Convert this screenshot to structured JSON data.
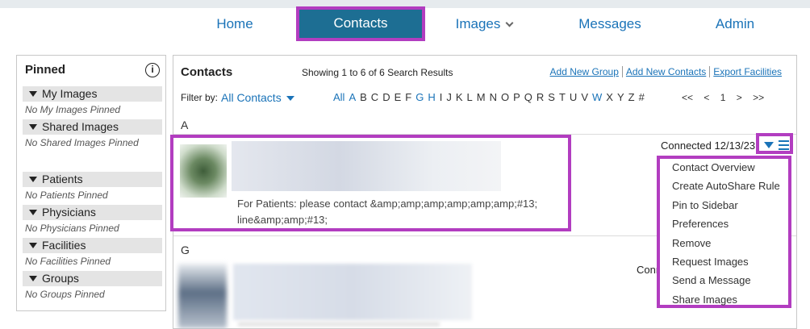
{
  "nav": {
    "home": "Home",
    "contacts": "Contacts",
    "images": "Images",
    "messages": "Messages",
    "admin": "Admin"
  },
  "pinned": {
    "title": "Pinned",
    "sections": [
      {
        "label": "My Images",
        "empty": "No My Images Pinned"
      },
      {
        "label": "Shared Images",
        "empty": "No Shared Images Pinned"
      },
      {
        "label": "Patients",
        "empty": "No Patients Pinned"
      },
      {
        "label": "Physicians",
        "empty": "No Physicians Pinned"
      },
      {
        "label": "Facilities",
        "empty": "No Facilities Pinned"
      },
      {
        "label": "Groups",
        "empty": "No Groups Pinned"
      }
    ]
  },
  "contacts": {
    "title": "Contacts",
    "results": "Showing 1 to 6 of 6 Search Results",
    "links": {
      "add_group": "Add New Group",
      "add_contacts": "Add New Contacts",
      "export": "Export Facilities"
    },
    "filter_label": "Filter by:",
    "filter_value": "All Contacts",
    "alphabet": [
      "All",
      "A",
      "B",
      "C",
      "D",
      "E",
      "F",
      "G",
      "H",
      "I",
      "J",
      "K",
      "L",
      "M",
      "N",
      "O",
      "P",
      "Q",
      "R",
      "S",
      "T",
      "U",
      "V",
      "W",
      "X",
      "Y",
      "Z",
      "#"
    ],
    "alphabet_links": [
      "All",
      "A",
      "G",
      "H",
      "W"
    ],
    "pager": {
      "first": "<<",
      "prev": "<",
      "page": "1",
      "next": ">",
      "last": ">>"
    },
    "section_a": "A",
    "section_g": "G",
    "row1": {
      "note_line1": "For Patients: please contact &amp;amp;amp;amp;amp;amp;#13;",
      "note_line2": "line&amp;amp;#13;",
      "status": "Connected 12/13/23"
    },
    "row2": {
      "status": "Conn"
    }
  },
  "menu": {
    "items": [
      "Contact Overview",
      "Create AutoShare Rule",
      "Pin to Sidebar",
      "Preferences",
      "Remove",
      "Request Images",
      "Send a Message",
      "Share Images"
    ]
  },
  "colors": {
    "accent": "#1d6e93",
    "link": "#1a73b8",
    "highlight": "#b23dc0"
  }
}
